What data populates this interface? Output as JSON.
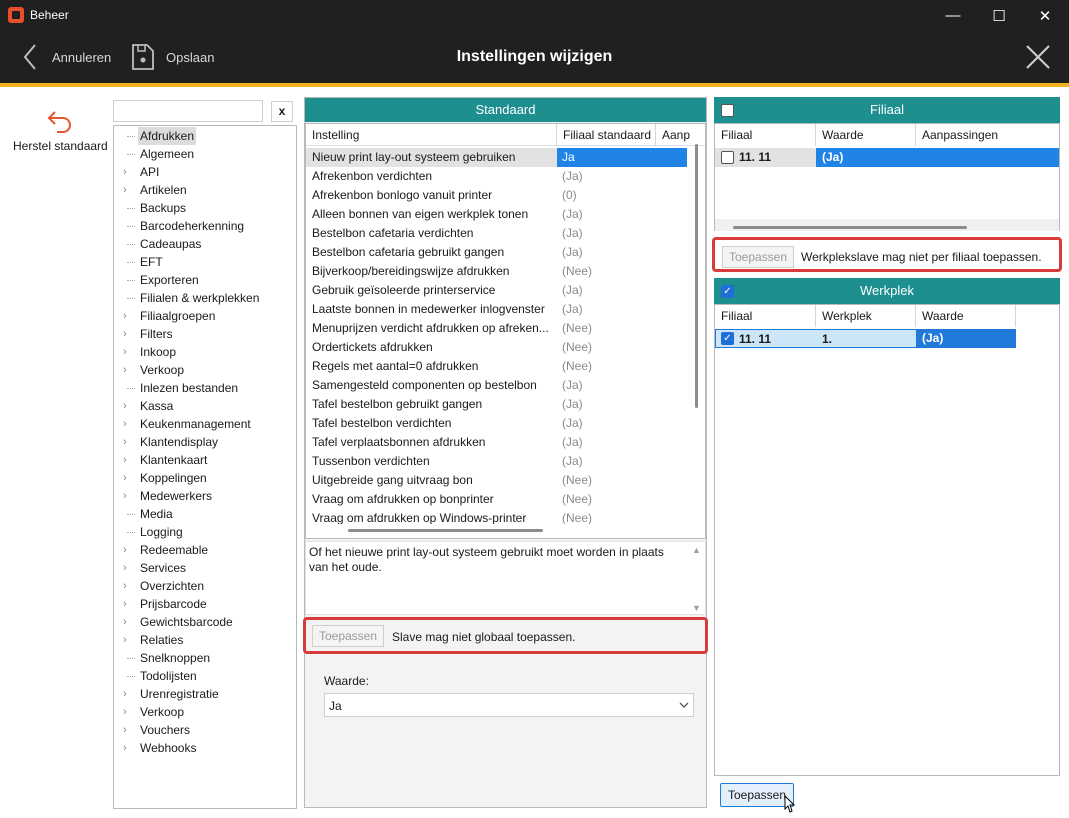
{
  "window": {
    "title": "Beheer",
    "minimize": "—",
    "maximize": "☐",
    "close": "✕"
  },
  "header": {
    "cancel_label": "Annuleren",
    "save_label": "Opslaan",
    "title": "Instellingen wijzigen"
  },
  "left": {
    "restore_label": "Herstel standaard",
    "search_value": "",
    "clear_label": "x",
    "tree": [
      {
        "label": "Afdrukken",
        "expandable": false,
        "selected": true
      },
      {
        "label": "Algemeen",
        "expandable": false
      },
      {
        "label": "API",
        "expandable": true
      },
      {
        "label": "Artikelen",
        "expandable": true
      },
      {
        "label": "Backups",
        "expandable": false
      },
      {
        "label": "Barcodeherkenning",
        "expandable": false
      },
      {
        "label": "Cadeaupas",
        "expandable": false
      },
      {
        "label": "EFT",
        "expandable": false
      },
      {
        "label": "Exporteren",
        "expandable": false
      },
      {
        "label": "Filialen & werkplekken",
        "expandable": false
      },
      {
        "label": "Filiaalgroepen",
        "expandable": true
      },
      {
        "label": "Filters",
        "expandable": true
      },
      {
        "label": "Inkoop",
        "expandable": true
      },
      {
        "label": "Verkoop",
        "expandable": true
      },
      {
        "label": "Inlezen bestanden",
        "expandable": false
      },
      {
        "label": "Kassa",
        "expandable": true
      },
      {
        "label": "Keukenmanagement",
        "expandable": true
      },
      {
        "label": "Klantendisplay",
        "expandable": true
      },
      {
        "label": "Klantenkaart",
        "expandable": true
      },
      {
        "label": "Koppelingen",
        "expandable": true
      },
      {
        "label": "Medewerkers",
        "expandable": true
      },
      {
        "label": "Media",
        "expandable": false
      },
      {
        "label": "Logging",
        "expandable": false
      },
      {
        "label": "Redeemable",
        "expandable": true
      },
      {
        "label": "Services",
        "expandable": true
      },
      {
        "label": "Overzichten",
        "expandable": true
      },
      {
        "label": "Prijsbarcode",
        "expandable": true
      },
      {
        "label": "Gewichtsbarcode",
        "expandable": true
      },
      {
        "label": "Relaties",
        "expandable": true
      },
      {
        "label": "Snelknoppen",
        "expandable": false
      },
      {
        "label": "Todolijsten",
        "expandable": false
      },
      {
        "label": "Urenregistratie",
        "expandable": true
      },
      {
        "label": "Verkoop",
        "expandable": true
      },
      {
        "label": "Vouchers",
        "expandable": true
      },
      {
        "label": "Webhooks",
        "expandable": true
      }
    ]
  },
  "standaard": {
    "title": "Standaard",
    "columns": [
      "Instelling",
      "Filiaal standaard",
      "Aanp"
    ],
    "rows": [
      {
        "name": "Nieuw print lay-out systeem gebruiken",
        "value": "Ja",
        "selected": true
      },
      {
        "name": "Afrekenbon verdichten",
        "value": "(Ja)"
      },
      {
        "name": "Afrekenbon bonlogo vanuit printer",
        "value": "(0)"
      },
      {
        "name": "Alleen bonnen van eigen werkplek tonen",
        "value": "(Ja)"
      },
      {
        "name": "Bestelbon cafetaria verdichten",
        "value": "(Ja)"
      },
      {
        "name": "Bestelbon cafetaria gebruikt gangen",
        "value": "(Ja)"
      },
      {
        "name": "Bijverkoop/bereidingswijze afdrukken",
        "value": "(Nee)"
      },
      {
        "name": "Gebruik geïsoleerde printerservice",
        "value": "(Ja)"
      },
      {
        "name": "Laatste bonnen in medewerker inlogvenster",
        "value": "(Ja)"
      },
      {
        "name": "Menuprijzen verdicht afdrukken op afreken...",
        "value": "(Nee)"
      },
      {
        "name": "Ordertickets afdrukken",
        "value": "(Nee)"
      },
      {
        "name": "Regels met aantal=0 afdrukken",
        "value": "(Nee)"
      },
      {
        "name": "Samengesteld componenten op bestelbon",
        "value": "(Ja)"
      },
      {
        "name": "Tafel bestelbon gebruikt gangen",
        "value": "(Ja)"
      },
      {
        "name": "Tafel bestelbon verdichten",
        "value": "(Ja)"
      },
      {
        "name": "Tafel verplaatsbonnen afdrukken",
        "value": "(Ja)"
      },
      {
        "name": "Tussenbon verdichten",
        "value": "(Ja)"
      },
      {
        "name": "Uitgebreide gang uitvraag bon",
        "value": "(Nee)"
      },
      {
        "name": "Vraag om afdrukken op bonprinter",
        "value": "(Nee)"
      },
      {
        "name": "Vraag om afdrukken op Windows-printer",
        "value": "(Nee)"
      }
    ],
    "description": "Of het nieuwe print lay-out systeem gebruikt moet worden in plaats van het oude.",
    "apply_label": "Toepassen",
    "apply_message": "Slave mag niet globaal toepassen.",
    "value_label": "Waarde:",
    "value_selected": "Ja"
  },
  "filiaal": {
    "title": "Filiaal",
    "columns": [
      "Filiaal",
      "Waarde",
      "Aanpassingen"
    ],
    "row": {
      "filiaal": "11. 11",
      "waarde": "(Ja)",
      "aanpassingen": ""
    },
    "apply_label": "Toepassen",
    "apply_message": "Werkplekslave mag niet per filiaal toepassen."
  },
  "werkplek": {
    "title": "Werkplek",
    "columns": [
      "Filiaal",
      "Werkplek",
      "Waarde"
    ],
    "row": {
      "filiaal": "11. 11",
      "werkplek": "1.",
      "waarde": "(Ja)"
    },
    "apply_label": "Toepassen"
  },
  "colors": {
    "accent": "#f2b21f",
    "teal": "#1d8f8f",
    "highlight": "#d93a3a",
    "select": "#1f7ad9"
  }
}
